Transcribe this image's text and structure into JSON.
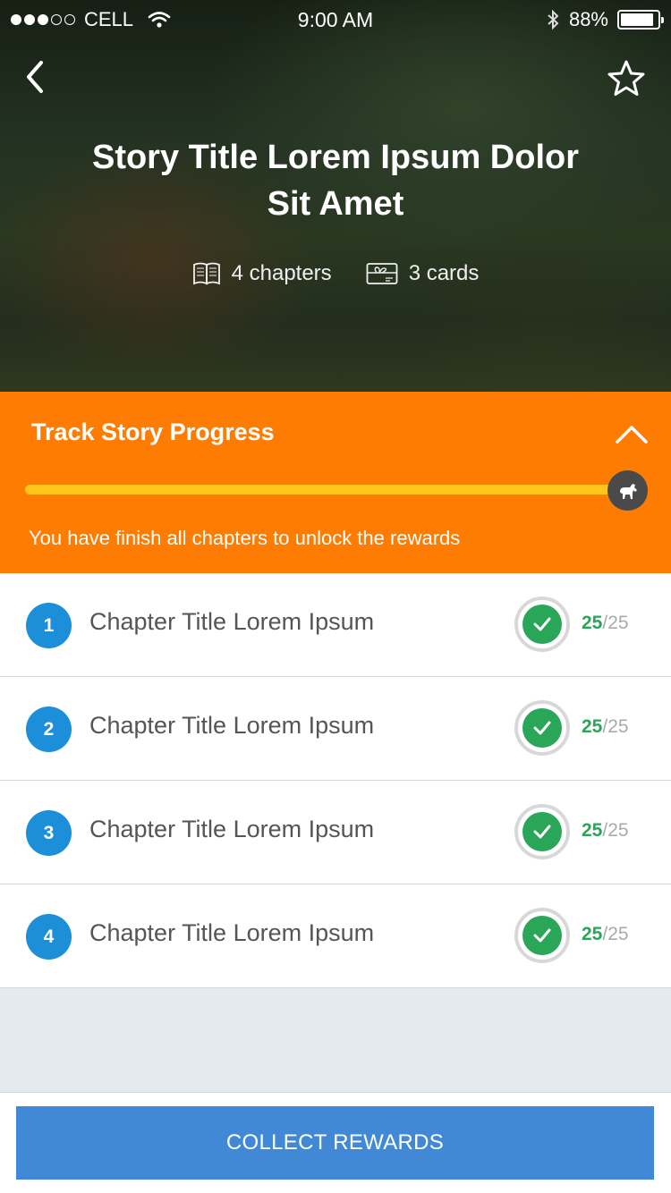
{
  "status_bar": {
    "carrier": "CELL",
    "time": "9:00 AM",
    "battery": "88%",
    "signal_icon": "signal-dots-icon",
    "wifi_icon": "wifi-icon",
    "bluetooth_icon": "bluetooth-icon"
  },
  "hero": {
    "title": "Story Title Lorem Ipsum Dolor Sit Amet",
    "chapters_label": "4 chapters",
    "cards_label": "3 cards",
    "back_icon": "chevron-left-icon",
    "favorite_icon": "star-icon",
    "chapters_icon": "book-icon",
    "cards_icon": "gift-card-icon"
  },
  "progress": {
    "title": "Track Story Progress",
    "note": "You have finish all chapters to unlock the rewards",
    "fraction": 1.0,
    "collapse_icon": "chevron-up-icon",
    "knob_icon": "horse-icon",
    "colors": {
      "panel": "#ff7c03",
      "bar": "#ffc51a"
    }
  },
  "chapters": [
    {
      "number": "1",
      "title": "Chapter Title Lorem Ipsum",
      "score": "25",
      "total": "/25"
    },
    {
      "number": "2",
      "title": "Chapter Title Lorem Ipsum",
      "score": "25",
      "total": "/25"
    },
    {
      "number": "3",
      "title": "Chapter Title Lorem Ipsum",
      "score": "25",
      "total": "/25"
    },
    {
      "number": "4",
      "title": "Chapter Title Lorem Ipsum",
      "score": "25",
      "total": "/25"
    }
  ],
  "footer": {
    "collect_label": "COLLECT REWARDS",
    "button_color": "#4189d6"
  }
}
